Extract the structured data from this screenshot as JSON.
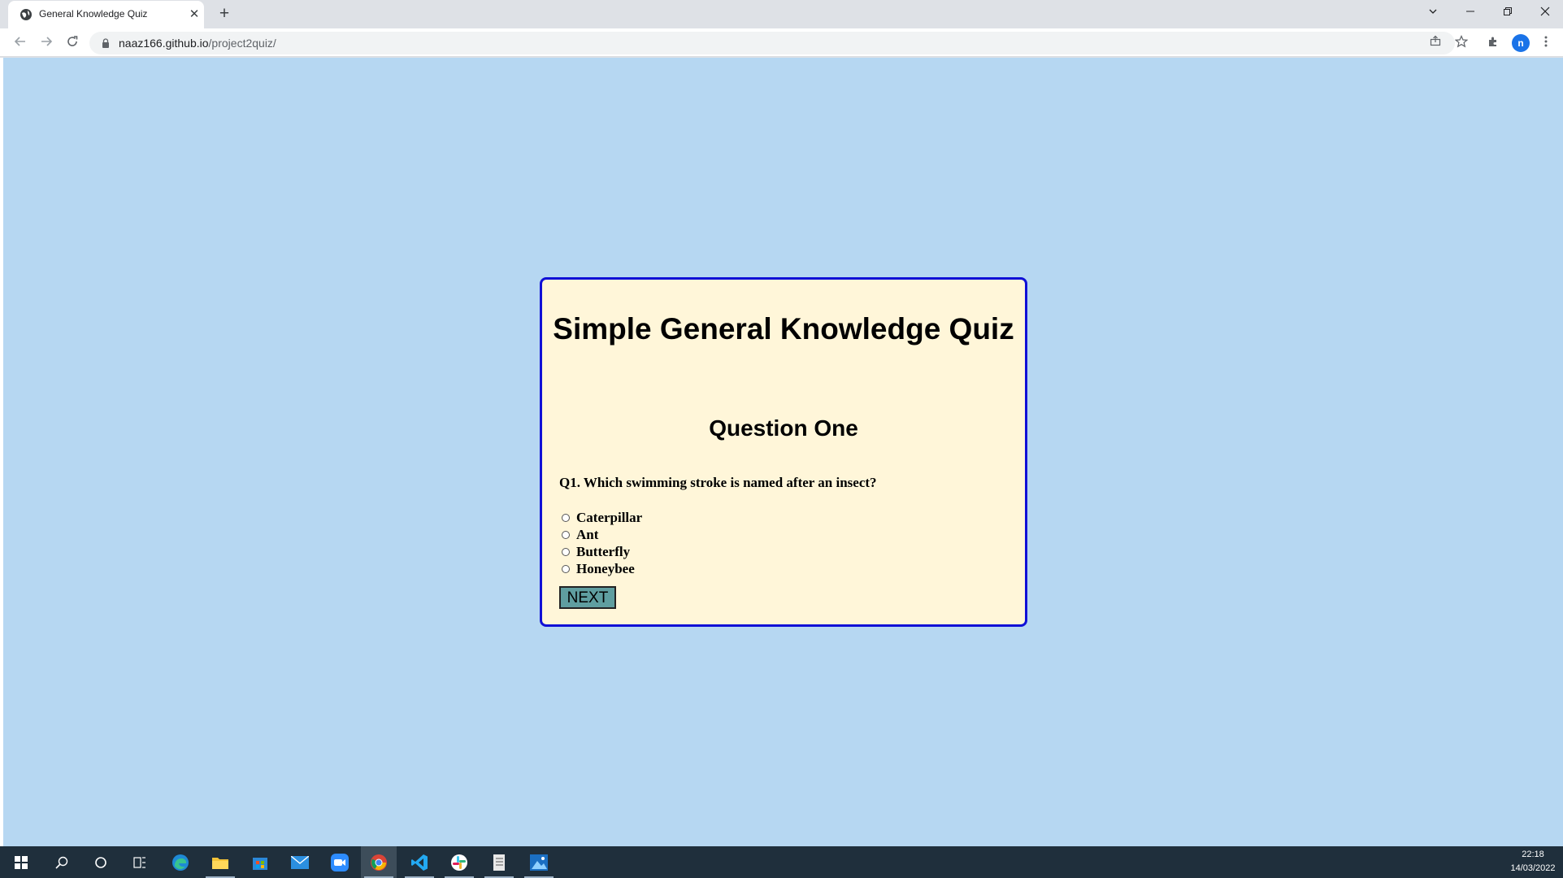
{
  "browser": {
    "tab_title": "General Knowledge Quiz",
    "tab_close": "✕",
    "new_tab": "+",
    "url_host": "naaz166.github.io",
    "url_path": "/project2quiz/",
    "profile_initial": "n"
  },
  "quiz": {
    "title": "Simple General Knowledge Quiz",
    "question_heading": "Question One",
    "question_text": "Q1. Which swimming stroke is named after an insect?",
    "options": [
      "Caterpillar",
      "Ant",
      "Butterfly",
      "Honeybee"
    ],
    "next_label": "NEXT"
  },
  "taskbar": {
    "time": "22:18",
    "date": "14/03/2022"
  },
  "colors": {
    "page_background": "#b6d7f2",
    "card_background": "#fff6d9",
    "card_border": "#1010d6",
    "next_button": "#5f9ea0"
  }
}
